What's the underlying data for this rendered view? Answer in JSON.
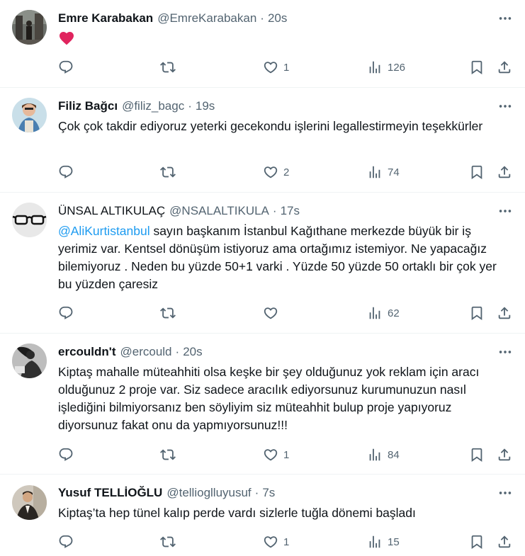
{
  "tweets": [
    {
      "name": "Emre Karabakan",
      "handle": "@EmreKarabakan",
      "sep": "·",
      "time": "20s",
      "text": "",
      "emoji": "red-heart",
      "likes": "1",
      "views": "126"
    },
    {
      "name": "Filiz Bağcı",
      "handle": "@filiz_bagc",
      "sep": "·",
      "time": "19s",
      "text": "Çok çok takdir ediyoruz yeterki gecekondu işlerini legallestirmeyin teşekkürler",
      "likes": "2",
      "views": "74"
    },
    {
      "name": "ÜNSAL ALTIKULAÇ",
      "handle": "@NSALALTIKULA",
      "sep": "·",
      "time": "17s",
      "mention": "@AliKurtistanbul",
      "text": " sayın başkanım İstanbul Kağıthane merkezde büyük bir  iş yerimiz var. Kentsel dönüşüm istiyoruz ama ortağımız istemiyor. Ne yapacağız bilemiyoruz . Neden bu yüzde 50+1 varki . Yüzde 50 yüzde 50 ortaklı bir çok yer bu yüzden çaresiz",
      "likes": "",
      "views": "62"
    },
    {
      "name": "ercouldn't",
      "handle": "@ercould",
      "sep": "·",
      "time": "20s",
      "text": "Kiptaş mahalle müteahhiti olsa keşke bir şey olduğunuz yok reklam için aracı olduğunuz 2 proje var. Siz sadece aracılık ediyorsunuz kurumunuzun nasıl işlediğini bilmiyorsanız ben söyliyim siz müteahhit bulup proje yapıyoruz diyorsunuz fakat onu da yapmıyorsunuz!!!",
      "likes": "1",
      "views": "84"
    },
    {
      "name": "Yusuf TELLİOĞLU",
      "handle": "@tellioglluyusuf",
      "sep": "·",
      "time": "7s",
      "text": "Kiptaş’ta hep tünel kalıp perde vardı sizlerle tuğla dönemi başladı",
      "likes": "1",
      "views": "15"
    }
  ],
  "icons": {
    "reply": "reply-icon",
    "retweet": "retweet-icon",
    "like": "heart-icon",
    "views": "views-icon",
    "bookmark": "bookmark-icon",
    "share": "share-icon",
    "more": "more-icon"
  },
  "colors": {
    "text": "#0f1419",
    "secondary": "#536471",
    "mention": "#1d9bf0",
    "divider": "#eff3f4",
    "heart": "#e0245e"
  }
}
